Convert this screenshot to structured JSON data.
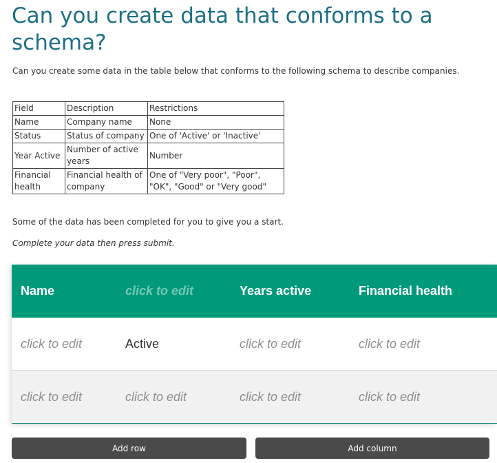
{
  "page": {
    "title": "Can you create data that conforms to a schema?",
    "intro": "Can you create some data in the table below that conforms to the following schema to describe companies.",
    "note": "Some of the data has been completed for you to give you a start.",
    "instruction": "Complete your data then press submit."
  },
  "schema_table": {
    "headers": [
      "Field",
      "Description",
      "Restrictions"
    ],
    "rows": [
      [
        "Name",
        "Company name",
        "None"
      ],
      [
        "Status",
        "Status of company",
        "One of 'Active' or 'Inactive'"
      ],
      [
        "Year Active",
        "Number of active years",
        "Number"
      ],
      [
        "Financial health",
        "Financial health of company",
        "One of \"Very poor\", \"Poor\", \"OK\", \"Good\" or \"Very good\""
      ]
    ]
  },
  "data_grid": {
    "headers": [
      "Name",
      "click to edit",
      "Years active",
      "Financial health"
    ],
    "rows": [
      [
        "click to edit",
        "Active",
        "click to edit",
        "click to edit"
      ],
      [
        "click to edit",
        "click to edit",
        "click to edit",
        "click to edit"
      ]
    ]
  },
  "buttons": {
    "add_row": "Add row",
    "add_column": "Add column"
  },
  "colors": {
    "title": "#1d6f86",
    "grid_header": "#009a7a",
    "button": "#4a4a4a",
    "placeholder": "#8f8f8f"
  }
}
